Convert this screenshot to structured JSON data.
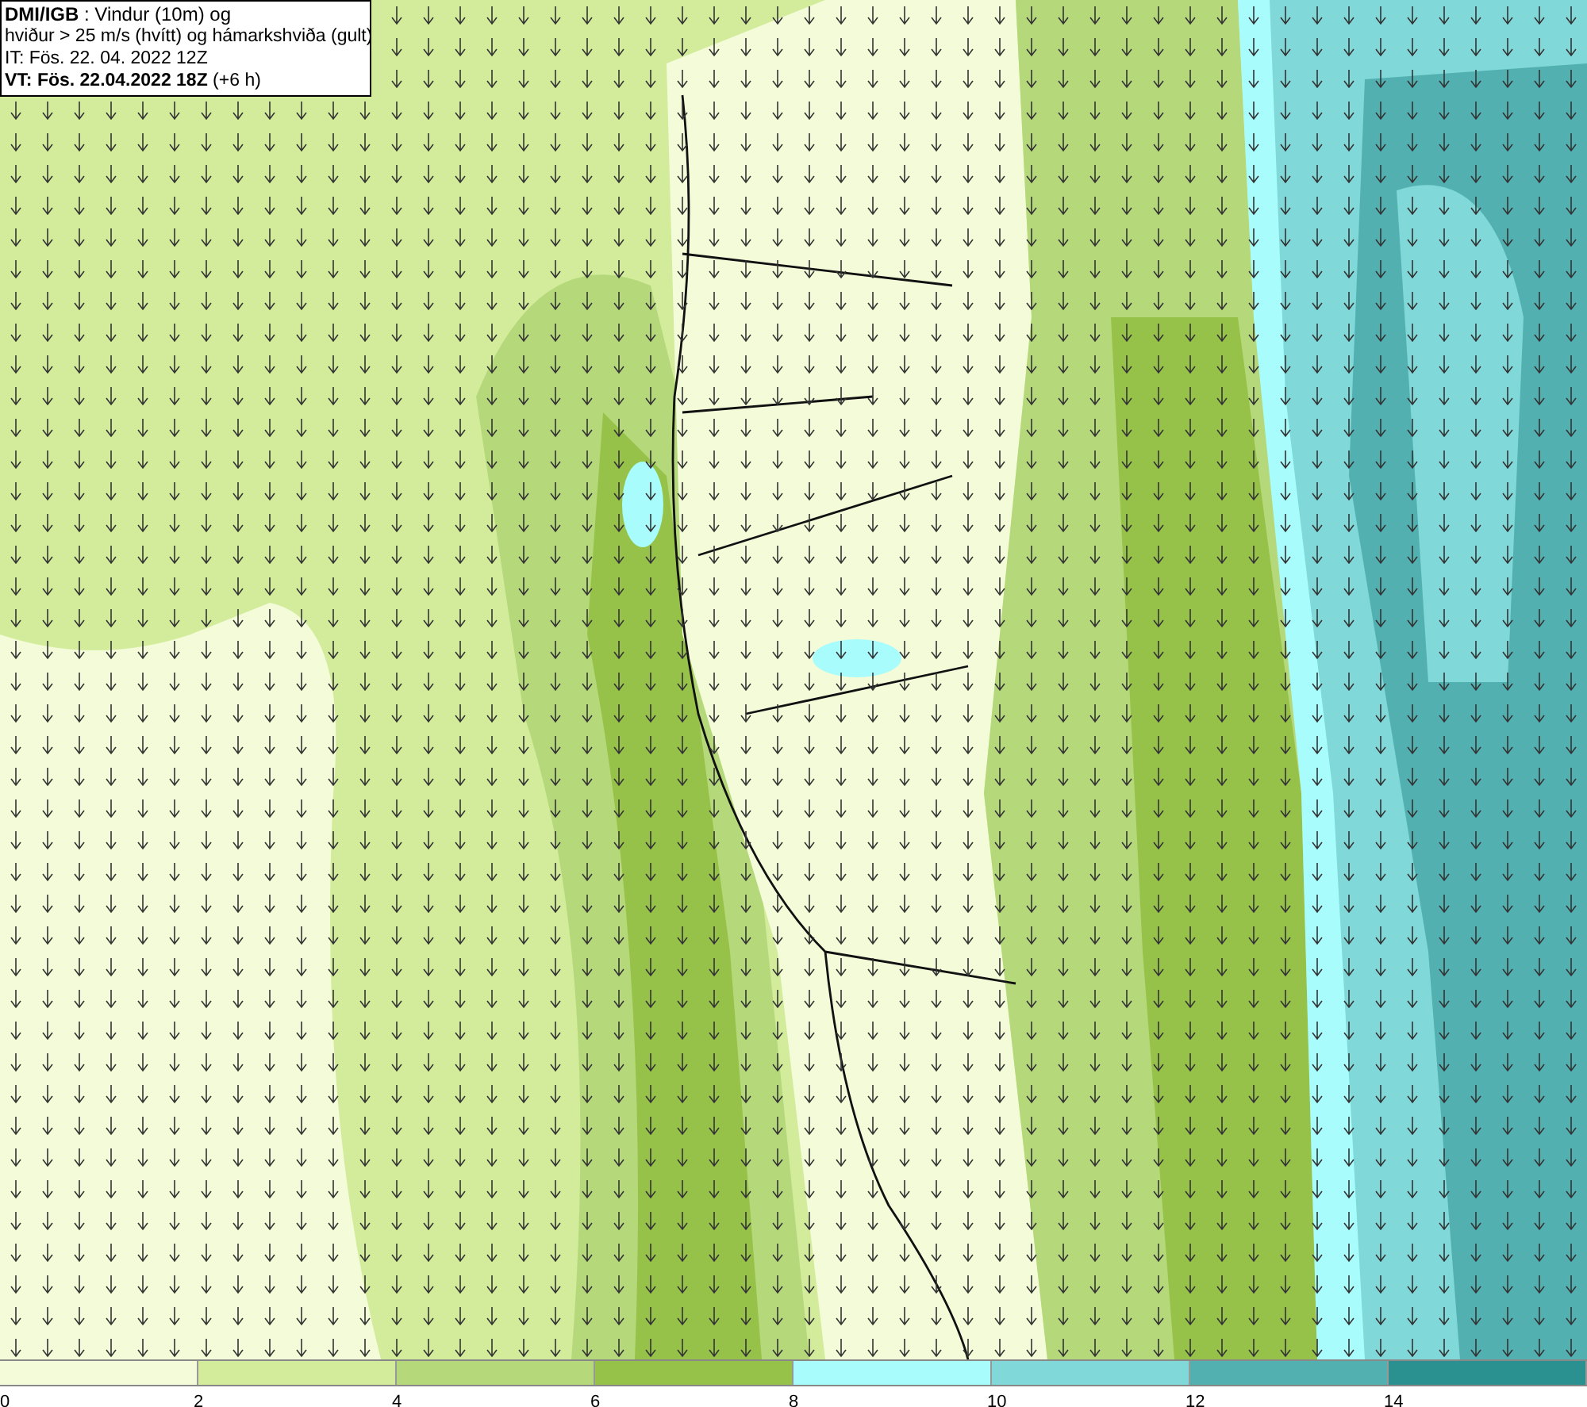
{
  "title_box": {
    "lines": [
      "**DMI/IGB** : Vindur (10m) og",
      "hviður > 25 m/s (hvítt) og hámarkshviða (gult)",
      "IT: Fös. 22. 04. 2022 12Z",
      "**VT: Fös. 22.04.2022 18Z** (+6 h)"
    ]
  },
  "color_scale": {
    "bins": [
      {
        "color": "#f4fbd9"
      },
      {
        "color": "#d3ec9c"
      },
      {
        "color": "#b5d97a"
      },
      {
        "color": "#97c24a"
      },
      {
        "color": "#a8fcfc"
      },
      {
        "color": "#80d8d8"
      },
      {
        "color": "#52b0b0"
      },
      {
        "color": "#2a9090"
      }
    ],
    "labels": [
      "0",
      "2",
      "4",
      "6",
      "8",
      "10",
      "12",
      "14"
    ]
  }
}
